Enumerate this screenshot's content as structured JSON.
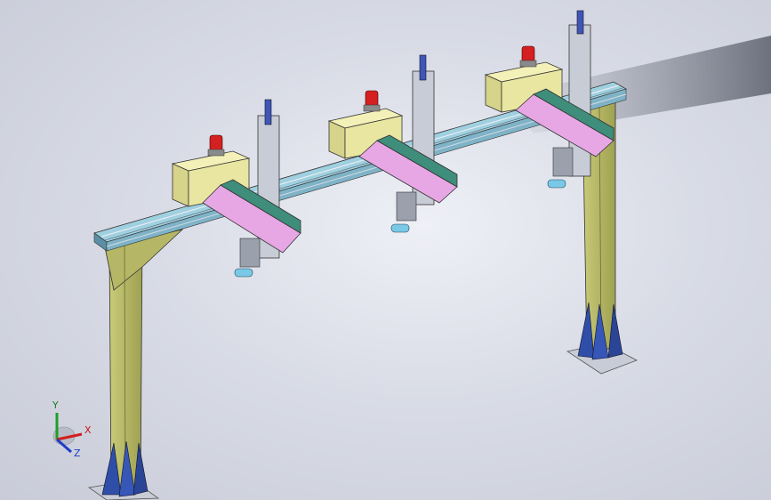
{
  "viewport": {
    "background_top": "#eef0f6",
    "background_edge": "#c9ccd8"
  },
  "colors": {
    "column": "#b9bb69",
    "column_dark": "#8e9047",
    "beam": "#8fc3d6",
    "beam_dark": "#5b8fa5",
    "cabinet": "#e9e6a2",
    "arm_top": "#e7a7e4",
    "arm_side": "#3f8d7b",
    "beacon": "#d42020",
    "gusset": "#2f4ea8",
    "rail": "#c8ccd6"
  },
  "triad": {
    "x_label": "X",
    "y_label": "Y",
    "z_label": "Z",
    "x_color": "#d21e1e",
    "y_color": "#1e9e2a",
    "z_color": "#1e3cc8"
  },
  "icons": {
    "triad": "coordinate-triad-icon",
    "beacon": "warning-beacon-icon"
  }
}
